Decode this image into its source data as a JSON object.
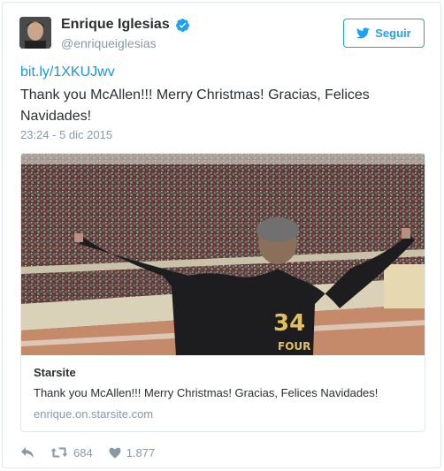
{
  "user": {
    "display_name": "Enrique Iglesias",
    "handle": "@enriqueiglesias",
    "verified_icon": "verified-badge-icon"
  },
  "follow": {
    "label": "Seguir",
    "icon": "twitter-bird-icon"
  },
  "tweet": {
    "link": "bit.ly/1XKUJwv",
    "text": "Thank you McAllen!!! Merry Christmas! Gracias, Felices Navidades!",
    "timestamp": "23:24 - 5 dic 2015"
  },
  "card": {
    "image": "concert-crowd-photo",
    "title": "Starsite",
    "description": "Thank you McAllen!!! Merry Christmas! Gracias, Felices Navidades!",
    "domain": "enrique.on.starsite.com"
  },
  "actions": {
    "reply_icon": "reply-icon",
    "retweet_icon": "retweet-icon",
    "retweet_count": "684",
    "like_icon": "heart-icon",
    "like_count": "1.877"
  },
  "colors": {
    "accent": "#1da1f2",
    "link": "#1b95e0",
    "muted": "#8899a6",
    "text": "#292f33",
    "border": "#e1e8ed"
  }
}
